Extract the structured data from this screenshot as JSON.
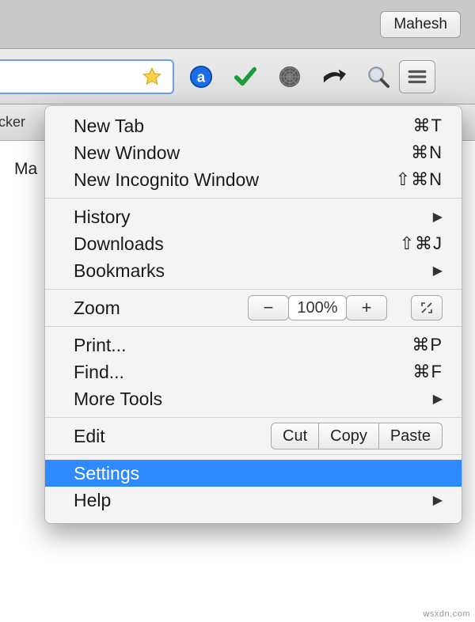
{
  "topbar": {
    "user": "Mahesh"
  },
  "toolbar": {
    "icons": [
      "star-icon",
      "a-badge-icon",
      "checkmark-icon",
      "spider-icon",
      "share-icon",
      "search-icon",
      "menu-icon"
    ]
  },
  "tabstrip": {
    "tab_cut": "cker"
  },
  "page": {
    "text_cut": "Ma"
  },
  "menu": {
    "group1": {
      "newtab": {
        "label": "New Tab",
        "shortcut": "⌘T"
      },
      "newwin": {
        "label": "New Window",
        "shortcut": "⌘N"
      },
      "newincog": {
        "label": "New Incognito Window",
        "shortcut": "⇧⌘N"
      }
    },
    "group2": {
      "history": {
        "label": "History"
      },
      "downloads": {
        "label": "Downloads",
        "shortcut": "⇧⌘J"
      },
      "bookmarks": {
        "label": "Bookmarks"
      }
    },
    "zoom": {
      "label": "Zoom",
      "value": "100%"
    },
    "group4": {
      "print": {
        "label": "Print...",
        "shortcut": "⌘P"
      },
      "find": {
        "label": "Find...",
        "shortcut": "⌘F"
      },
      "moretools": {
        "label": "More Tools"
      }
    },
    "edit": {
      "label": "Edit",
      "cut": "Cut",
      "copy": "Copy",
      "paste": "Paste"
    },
    "group6": {
      "settings": {
        "label": "Settings"
      },
      "help": {
        "label": "Help"
      }
    }
  },
  "watermark": "wsxdn.com"
}
